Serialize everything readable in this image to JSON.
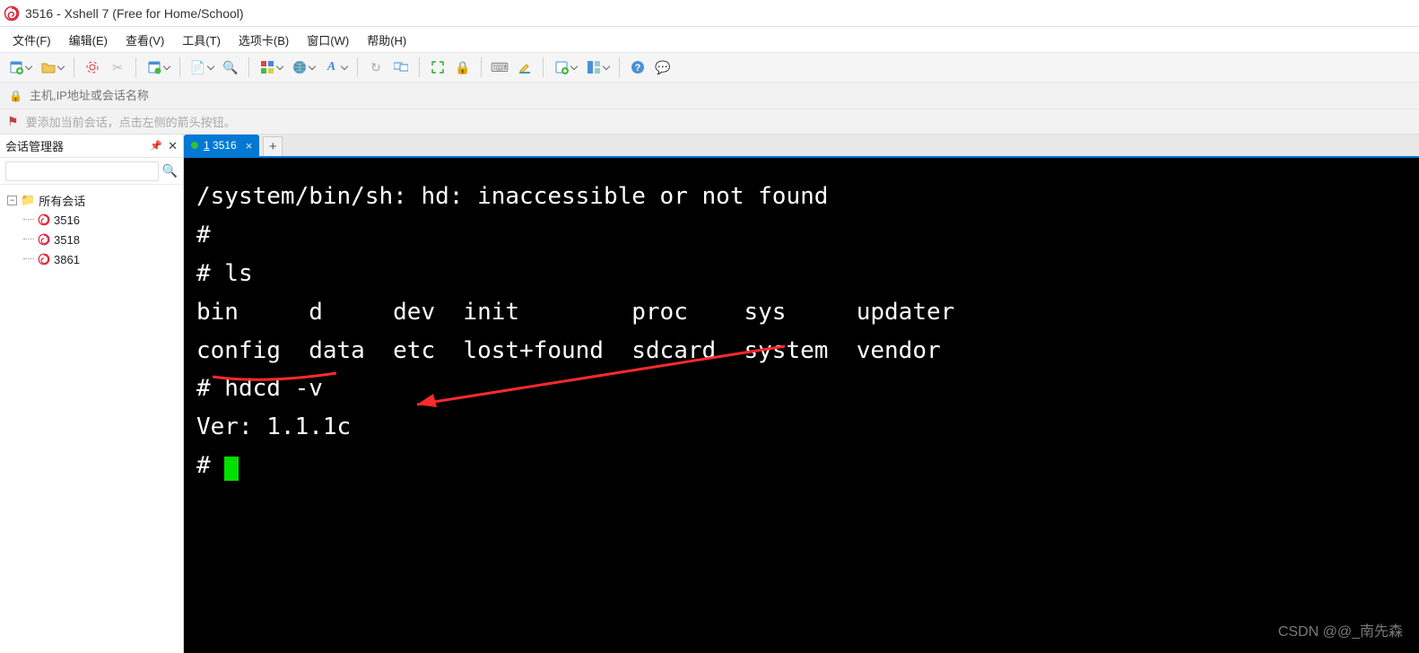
{
  "window": {
    "title": "3516 - Xshell 7 (Free for Home/School)"
  },
  "menu": {
    "file": "文件(F)",
    "edit": "编辑(E)",
    "view": "查看(V)",
    "tools": "工具(T)",
    "tabs": "选项卡(B)",
    "window": "窗口(W)",
    "help": "帮助(H)"
  },
  "addressbar": {
    "placeholder": "主机,IP地址或会话名称"
  },
  "hintbar": {
    "text": "要添加当前会话，点击左侧的箭头按钮。"
  },
  "sidebar": {
    "title": "会话管理器",
    "root": "所有会话",
    "items": [
      "3516",
      "3518",
      "3861"
    ]
  },
  "tab": {
    "label": "1 3516"
  },
  "terminal": {
    "lines": [
      "/system/bin/sh: hd: inaccessible or not found",
      "#",
      "# ls",
      "bin     d     dev  init        proc    sys     updater",
      "config  data  etc  lost+found  sdcard  system  vendor",
      "# hdcd -v",
      "Ver: 1.1.1c",
      "# "
    ]
  },
  "watermark": "CSDN @@_南先森"
}
